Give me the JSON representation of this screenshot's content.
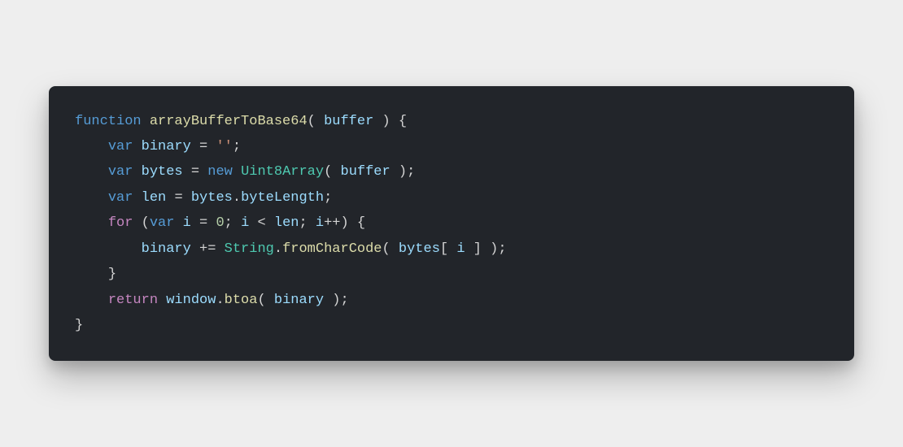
{
  "code": {
    "line1": {
      "function_kw": "function",
      "funcname": "arrayBufferToBase64",
      "open_paren": "( ",
      "param": "buffer",
      "close_paren": " ) {",
      "space1": " "
    },
    "line2": {
      "indent": "    ",
      "var_kw": "var",
      "space1": " ",
      "varname": "binary",
      "space2": " ",
      "op": "=",
      "space3": " ",
      "str": "''",
      "semi": ";"
    },
    "line3": {
      "indent": "    ",
      "var_kw": "var",
      "space1": " ",
      "varname": "bytes",
      "space2": " ",
      "op": "=",
      "space3": " ",
      "new_kw": "new",
      "space4": " ",
      "type": "Uint8Array",
      "open_paren": "( ",
      "param": "buffer",
      "close_paren": " );"
    },
    "line4": {
      "indent": "    ",
      "var_kw": "var",
      "space1": " ",
      "varname": "len",
      "space2": " ",
      "op": "=",
      "space3": " ",
      "obj": "bytes",
      "dot": ".",
      "prop": "byteLength",
      "semi": ";"
    },
    "line5": {
      "indent": "    ",
      "for_kw": "for",
      "space1": " ",
      "open_paren": "(",
      "var_kw": "var",
      "space2": " ",
      "varname": "i",
      "space3": " ",
      "op1": "=",
      "space4": " ",
      "num": "0",
      "semi1": "; ",
      "varname2": "i",
      "space5": " ",
      "op2": "<",
      "space6": " ",
      "varname3": "len",
      "semi2": "; ",
      "varname4": "i",
      "op3": "++",
      "close_paren": ") {"
    },
    "line6": {
      "indent": "        ",
      "varname": "binary",
      "space1": " ",
      "op": "+=",
      "space2": " ",
      "type": "String",
      "dot": ".",
      "method": "fromCharCode",
      "open_paren": "( ",
      "obj": "bytes",
      "bracket_open": "[ ",
      "idx": "i",
      "bracket_close": " ] );"
    },
    "line7": {
      "indent": "    ",
      "brace": "}"
    },
    "line8": {
      "indent": "    ",
      "return_kw": "return",
      "space1": " ",
      "obj": "window",
      "dot": ".",
      "method": "btoa",
      "open_paren": "( ",
      "param": "binary",
      "close_paren": " );"
    },
    "line9": {
      "brace": "}"
    }
  }
}
